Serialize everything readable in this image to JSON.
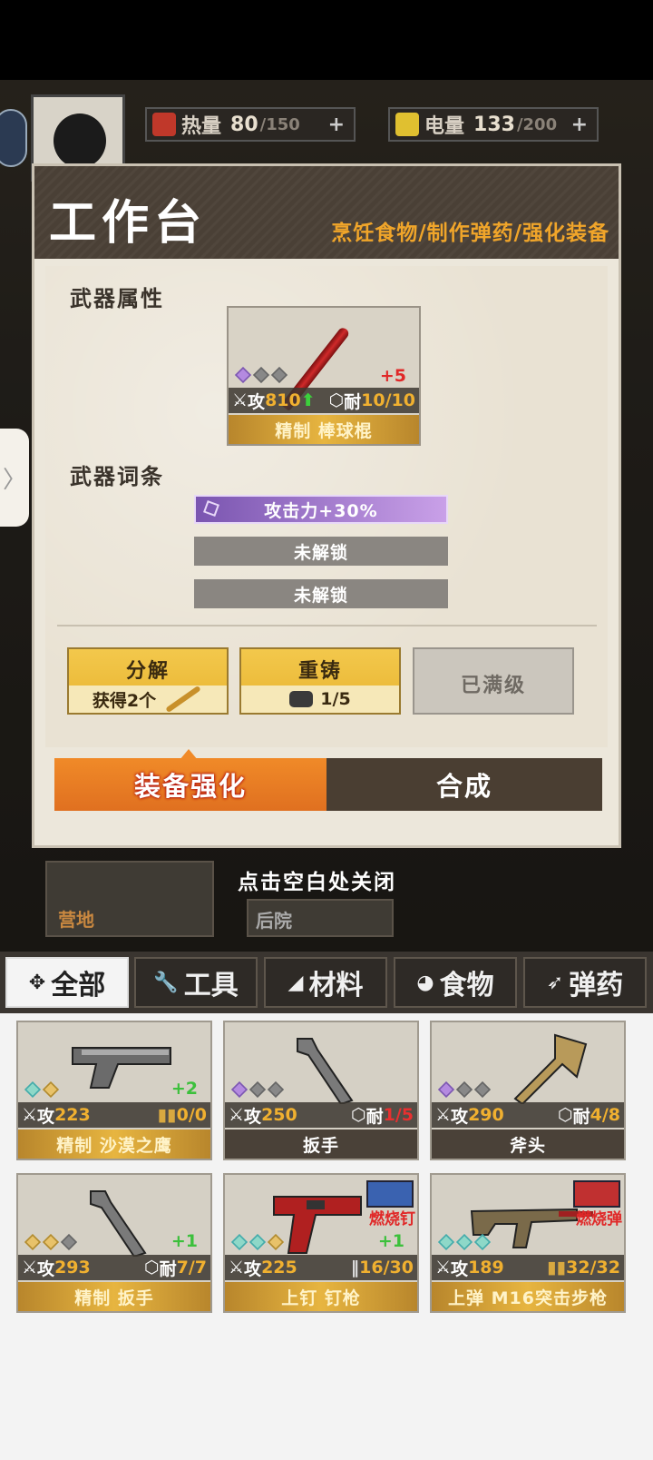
{
  "hud": {
    "heat": {
      "label": "热量",
      "value": "80",
      "max": "/150",
      "plus": "+"
    },
    "power": {
      "label": "电量",
      "value": "133",
      "max": "/200",
      "plus": "+"
    }
  },
  "modal": {
    "title": "工作台",
    "subtitle": "烹饪食物/制作弹药/强化装备",
    "attr_title": "武器属性",
    "weapon": {
      "plus": "+5",
      "atk_label": "攻",
      "atk_value": "810",
      "dur_label": "耐",
      "dur_value": "10/10",
      "name": "精制 棒球棍"
    },
    "affix_title": "武器词条",
    "affixes": [
      "攻击力+30%",
      "未解锁",
      "未解锁"
    ],
    "buttons": {
      "decompose": {
        "label": "分解",
        "sub": "获得2个"
      },
      "recast": {
        "label": "重铸",
        "sub": "1/5"
      },
      "maxed": {
        "label": "已满级"
      }
    },
    "tabs": {
      "enhance": "装备强化",
      "synth": "合成"
    }
  },
  "close_hint": "点击空白处关闭",
  "bg_labels": {
    "camp": "营地",
    "backyard": "后院"
  },
  "inventory": {
    "tabs": [
      {
        "label": "全部",
        "icon": "grid-icon"
      },
      {
        "label": "工具",
        "icon": "wrench-icon"
      },
      {
        "label": "材料",
        "icon": "material-icon"
      },
      {
        "label": "食物",
        "icon": "food-icon"
      },
      {
        "label": "弹药",
        "icon": "ammo-icon"
      }
    ],
    "items": [
      {
        "name": "精制 沙漠之鹰",
        "atk_label": "攻",
        "atk": "223",
        "right_value": "0/0",
        "plus": "+2"
      },
      {
        "name": "扳手",
        "atk_label": "攻",
        "atk": "250",
        "dur_label": "耐",
        "right_value": "1/5"
      },
      {
        "name": "斧头",
        "atk_label": "攻",
        "atk": "290",
        "dur_label": "耐",
        "right_value": "4/8"
      },
      {
        "name": "精制 扳手",
        "atk_label": "攻",
        "atk": "293",
        "dur_label": "耐",
        "right_value": "7/7",
        "plus": "+1"
      },
      {
        "name": "上钉 钉枪",
        "atk_label": "攻",
        "atk": "225",
        "right_value": "16/30",
        "plus": "+1",
        "tag": "燃烧钉"
      },
      {
        "name": "上弹 M16突击步枪",
        "atk_label": "攻",
        "atk": "189",
        "right_value": "32/32",
        "tag": "燃烧弹"
      }
    ]
  },
  "colors": {
    "accent_orange": "#f08a28",
    "gold": "#e7b540",
    "dark_brown": "#4a4036"
  }
}
